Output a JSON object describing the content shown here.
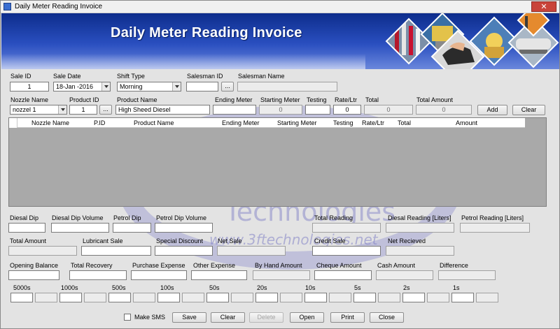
{
  "window": {
    "title": "Daily Meter Reading Invoice",
    "close_glyph": "✕"
  },
  "banner": {
    "title": "Daily Meter Reading Invoice"
  },
  "header": {
    "sale_id_label": "Sale ID",
    "sale_id": "1",
    "sale_date_label": "Sale Date",
    "sale_date": "18-Jan -2016",
    "shift_type_label": "Shift Type",
    "shift_type": "Morning",
    "salesman_id_label": "Salesman ID",
    "salesman_id": "",
    "salesman_browse": "...",
    "salesman_name_label": "Salesman Name",
    "salesman_name": ""
  },
  "entry": {
    "nozzle_name_label": "Nozzle Name",
    "nozzle_name": "nozzel 1",
    "product_id_label": "Product ID",
    "product_id": "1",
    "product_browse": "...",
    "product_name_label": "Product Name",
    "product_name": "High Sheed Diesel",
    "ending_meter_label": "Ending Meter",
    "ending_meter": "",
    "starting_meter_label": "Starting Meter",
    "starting_meter": "0",
    "testing_label": "Testing",
    "testing": "",
    "rate_label": "Rate/Ltr",
    "rate": "0",
    "total_label": "Total",
    "total": "0",
    "total_amount_label": "Total Amount",
    "total_amount": "0",
    "add_button": "Add",
    "clear_button": "Clear"
  },
  "grid": {
    "columns": [
      "Nozzle Name",
      "P.ID",
      "Product Name",
      "Ending Meter",
      "Starting Meter",
      "Testing",
      "Rate/Ltr",
      "Total",
      "Amount"
    ]
  },
  "watermark": {
    "brand": "3f",
    "tech": "Technologies",
    "url": "www.3ftechnologies.net"
  },
  "dips": {
    "diesal_dip": "Diesal Dip",
    "diesal_dip_volume": "Diesal Dip Volume",
    "petrol_dip": "Petrol Dip",
    "petrol_dip_volume": "Petrol Dip Volume",
    "total_reading": "Total Reading",
    "diesal_reading": "Diesal Reading [Liters]",
    "petrol_reading": "Petrol Reading [Liters]"
  },
  "sales": {
    "total_amount": "Total Amount",
    "lubricant_sale": "Lubricant Sale",
    "special_discount": "Special Discount",
    "net_sale": "Net Sale",
    "credit_sale": "Credit Sale",
    "net_recieved": "Net Recieved"
  },
  "balance": {
    "opening_balance": "Opening Balance",
    "total_recovery": "Total Recovery",
    "purchase_expense": "Purchase Expense",
    "other_expense": "Other Expense",
    "by_hand_amount": "By Hand Amount",
    "cheque_amount": "Cheque Amount",
    "cash_amount": "Cash Amount",
    "difference": "Difference"
  },
  "denominations": [
    "5000s",
    "1000s",
    "500s",
    "100s",
    "50s",
    "20s",
    "10s",
    "5s",
    "2s",
    "1s"
  ],
  "footer": {
    "make_sms": "Make SMS",
    "save": "Save",
    "clear": "Clear",
    "delete": "Delete",
    "open": "Open",
    "print": "Print",
    "close": "Close"
  }
}
